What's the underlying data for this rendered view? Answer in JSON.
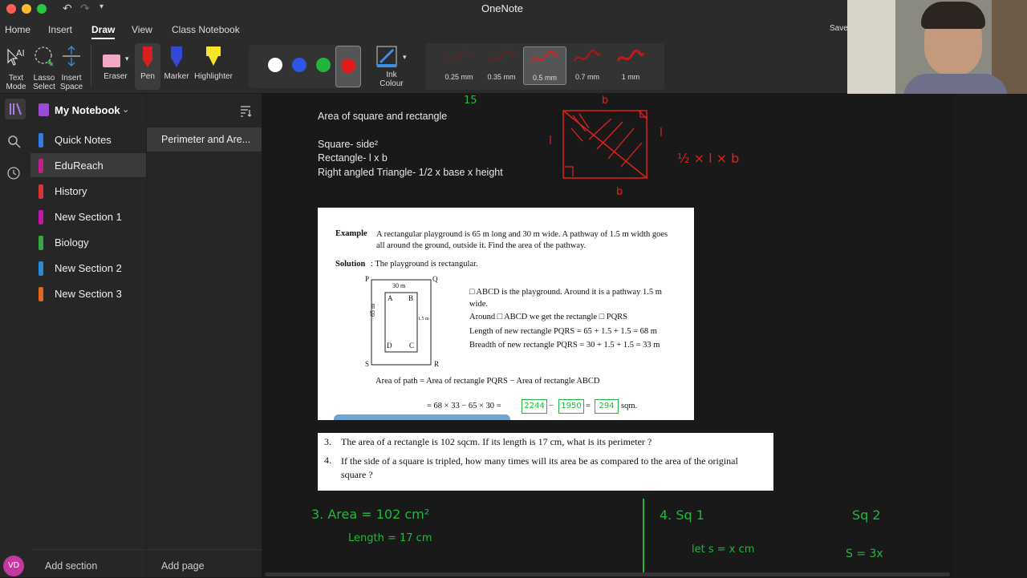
{
  "window": {
    "title": "OneNote",
    "saved_label": "Saved"
  },
  "menu": {
    "tabs": [
      "Home",
      "Insert",
      "Draw",
      "View",
      "Class Notebook"
    ],
    "active": "Draw"
  },
  "ribbon": {
    "tools": {
      "text_mode": "Text\nMode",
      "lasso_select": "Lasso\nSelect",
      "insert_space": "Insert\nSpace"
    },
    "eraser": "Eraser",
    "pen": "Pen",
    "marker": "Marker",
    "highlighter": "Highlighter",
    "ink_colour": "Ink\nColour",
    "colors": [
      "#ffffff",
      "#2d55e6",
      "#22b53b",
      "#e21c1c"
    ],
    "selected_color": "#e21c1c",
    "thickness": [
      "0.25 mm",
      "0.35 mm",
      "0.5 mm",
      "0.7 mm",
      "1 mm"
    ],
    "selected_thickness": "0.5 mm"
  },
  "notebook": {
    "name": "My Notebook",
    "sections": [
      {
        "label": "Quick Notes",
        "color": "#2f7ee6"
      },
      {
        "label": "EduReach",
        "color": "#c21f8a"
      },
      {
        "label": "History",
        "color": "#d6333a"
      },
      {
        "label": "New Section 1",
        "color": "#c417a8"
      },
      {
        "label": "Biology",
        "color": "#35a93f"
      },
      {
        "label": "New Section 2",
        "color": "#2b8ad9"
      },
      {
        "label": "New Section 3",
        "color": "#e0681b"
      }
    ],
    "selected_section": "EduReach",
    "add_section": "Add section",
    "pages": [
      "Perimeter and Are..."
    ],
    "add_page": "Add page",
    "avatar_initials": "VD"
  },
  "page": {
    "lines": [
      "Area of square and rectangle",
      "Square- side²",
      "Rectangle- l x b",
      "Right angled Triangle- 1/2 x base x height"
    ],
    "ink_top": {
      "num": "15",
      "b_top": "b",
      "l_left": "l",
      "l_right": "l",
      "b_bottom": "b",
      "formula": "½ × l × b"
    },
    "example": {
      "heading": "Example",
      "text": "A rectangular playground is 65 m long and 30 m wide. A pathway of 1.5 m width goes all around the ground, outside it. Find the area of the pathway.",
      "solution_label": "Solution",
      "solution_text": ": The playground is rectangular.",
      "fig": {
        "P": "P",
        "Q": "Q",
        "R": "R",
        "S": "S",
        "A": "A",
        "B": "B",
        "C": "C",
        "D": "D",
        "w": "30 m",
        "h": "65 m",
        "gap": "1.5 m"
      },
      "desc": [
        "□ ABCD is the playground. Around it is a pathway 1.5 m wide.",
        "Around □ ABCD we get the rectangle □ PQRS",
        "Length of new rectangle PQRS = 65 + 1.5 + 1.5 = 68 m",
        "Breadth of new rectangle PQRS = 30 + 1.5 + 1.5 = 33 m"
      ],
      "area_line": "Area of path = Area of rectangle PQRS − Area of rectangle ABCD",
      "calc_prefix": "= 68 × 33 − 65 × 30 =",
      "calc_a": "2244",
      "calc_b": "1950",
      "calc_c": "294",
      "calc_unit": "sqm."
    },
    "questions": [
      {
        "num": "3.",
        "text": "The area of a rectangle is 102 sqcm. If its length is 17 cm, what is its perimeter ?"
      },
      {
        "num": "4.",
        "text": "If the side of a square is tripled, how many times will its area be as compared to the area of the original square ?"
      }
    ],
    "ink_bottom": {
      "l1": "3. Area = 102 cm²",
      "l2": "Length = 17 cm",
      "r1": "4. Sq 1",
      "r2": "Sq 2",
      "r3": "let s = x cm",
      "r4": "S = 3x"
    }
  }
}
